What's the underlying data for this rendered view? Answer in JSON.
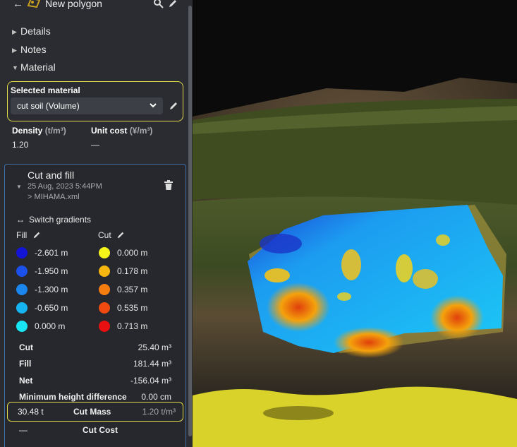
{
  "header": {
    "title": "New polygon",
    "back_icon": "arrow-left-icon",
    "search_icon": "zoom-icon",
    "edit_icon": "pencil-icon"
  },
  "sections": [
    {
      "label": "Details",
      "state": "collapsed"
    },
    {
      "label": "Notes",
      "state": "collapsed"
    },
    {
      "label": "Material",
      "state": "expanded"
    }
  ],
  "material": {
    "selected_label": "Selected material",
    "selected_value": "cut soil (Volume)",
    "density_label": "Density",
    "density_unit": "(t/m³)",
    "density_value": "1.20",
    "unit_cost_label": "Unit cost",
    "unit_cost_unit": "(¥/m³)",
    "unit_cost_value": "—",
    "highlight_color": "#e3d84a"
  },
  "cut_fill": {
    "title": "Cut and fill",
    "date": "25 Aug, 2023 5:44PM",
    "file": "> MIHAMA.xml",
    "switch_label": "Switch gradients",
    "fill_label": "Fill",
    "cut_label": "Cut",
    "fill_legend": [
      {
        "value": "-2.601 m",
        "color": "#1414d6"
      },
      {
        "value": "-1.950 m",
        "color": "#1c50ea"
      },
      {
        "value": "-1.300 m",
        "color": "#1b86ee"
      },
      {
        "value": "-0.650 m",
        "color": "#16b5f2"
      },
      {
        "value": "0.000 m",
        "color": "#19e6f5"
      }
    ],
    "cut_legend": [
      {
        "value": "0.000 m",
        "color": "#f5f51a"
      },
      {
        "value": "0.178 m",
        "color": "#f7b50f"
      },
      {
        "value": "0.357 m",
        "color": "#f57d0f"
      },
      {
        "value": "0.535 m",
        "color": "#f04a10"
      },
      {
        "value": "0.713 m",
        "color": "#e81010"
      }
    ],
    "stats": [
      {
        "label": "Cut",
        "value": "25.40 m³"
      },
      {
        "label": "Fill",
        "value": "181.44 m³"
      },
      {
        "label": "Net",
        "value": "-156.04 m³"
      },
      {
        "label": "Minimum height difference",
        "value": "0.00 cm"
      }
    ],
    "cut_mass": {
      "value": "30.48 t",
      "label": "Cut Mass",
      "unit": "1.20 t/m³"
    },
    "cut_cost": {
      "value": "—",
      "label": "Cut Cost"
    }
  }
}
